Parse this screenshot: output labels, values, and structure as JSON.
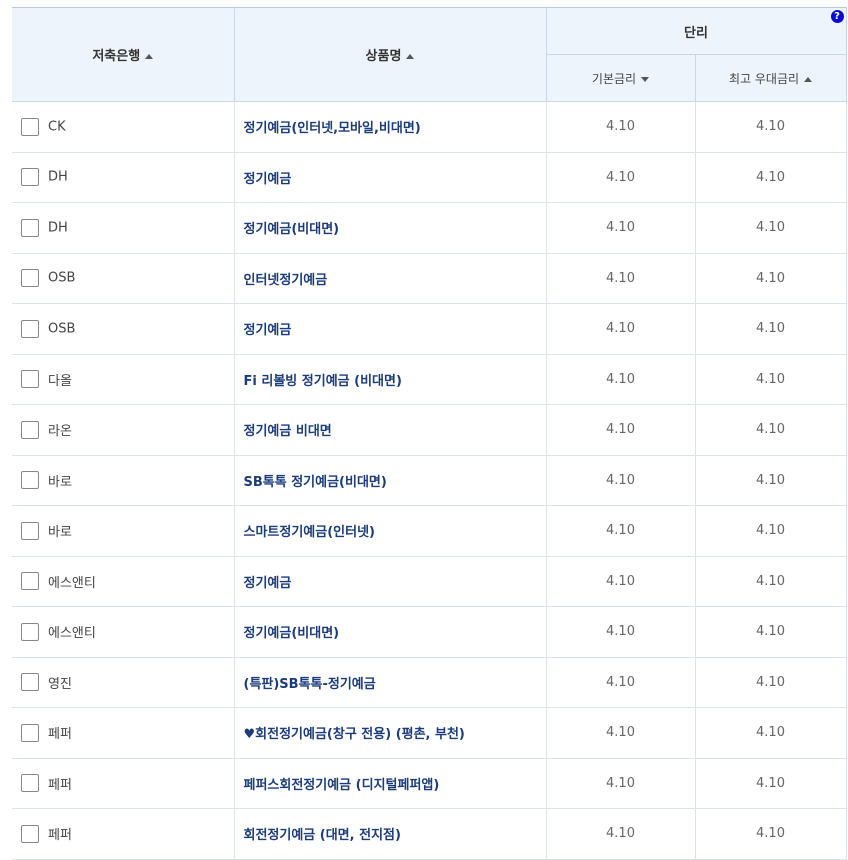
{
  "header": {
    "bank": "저축은행",
    "product": "상품명",
    "group": "단리",
    "base_rate": "기본금리",
    "max_rate": "최고 우대금리",
    "help": "?"
  },
  "rows": [
    {
      "bank": "CK",
      "product": "정기예금(인터넷,모바일,비대면)",
      "base": "4.10",
      "max": "4.10"
    },
    {
      "bank": "DH",
      "product": "정기예금",
      "base": "4.10",
      "max": "4.10"
    },
    {
      "bank": "DH",
      "product": "정기예금(비대면)",
      "base": "4.10",
      "max": "4.10"
    },
    {
      "bank": "OSB",
      "product": "인터넷정기예금",
      "base": "4.10",
      "max": "4.10"
    },
    {
      "bank": "OSB",
      "product": "정기예금",
      "base": "4.10",
      "max": "4.10"
    },
    {
      "bank": "다올",
      "product": "Fi 리볼빙 정기예금 (비대면)",
      "base": "4.10",
      "max": "4.10"
    },
    {
      "bank": "라온",
      "product": "정기예금 비대면",
      "base": "4.10",
      "max": "4.10"
    },
    {
      "bank": "바로",
      "product": "SB톡톡 정기예금(비대면)",
      "base": "4.10",
      "max": "4.10"
    },
    {
      "bank": "바로",
      "product": "스마트정기예금(인터넷)",
      "base": "4.10",
      "max": "4.10"
    },
    {
      "bank": "에스앤티",
      "product": "정기예금",
      "base": "4.10",
      "max": "4.10"
    },
    {
      "bank": "에스앤티",
      "product": "정기예금(비대면)",
      "base": "4.10",
      "max": "4.10"
    },
    {
      "bank": "영진",
      "product": "(특판)SB톡톡-정기예금",
      "base": "4.10",
      "max": "4.10"
    },
    {
      "bank": "페퍼",
      "product": "♥회전정기예금(창구 전용) (평촌, 부천)",
      "base": "4.10",
      "max": "4.10"
    },
    {
      "bank": "페퍼",
      "product": "페퍼스회전정기예금 (디지털페퍼앱)",
      "base": "4.10",
      "max": "4.10"
    },
    {
      "bank": "페퍼",
      "product": "회전정기예금 (대면, 전지점)",
      "base": "4.10",
      "max": "4.10"
    }
  ]
}
